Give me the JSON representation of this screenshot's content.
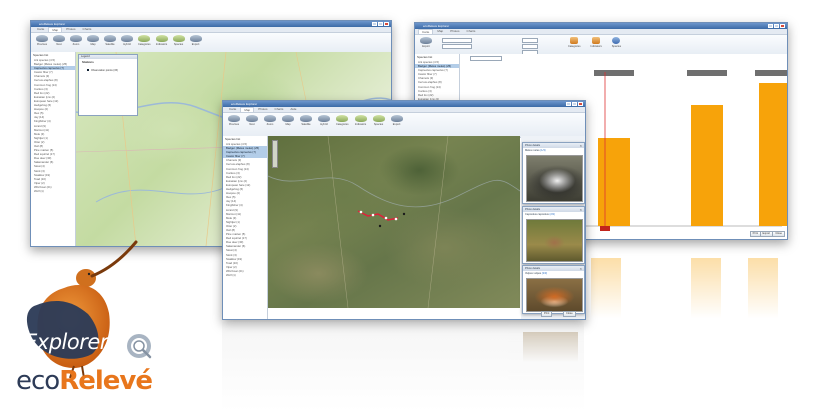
{
  "app": {
    "title": "ecoReleve Explorer",
    "brand_word1": "Explorer",
    "brand_eco": "eco",
    "brand_releve": "Relevé",
    "brand_orange": "#e8761c",
    "brand_blue": "#2d3b57"
  },
  "tabs": [
    "Carte",
    "Map",
    "Photos",
    "Charts",
    "Aide"
  ],
  "toolbar": {
    "labels": [
      "Previous",
      "Next",
      "Zoom",
      "Map",
      "Satellite",
      "Hybrid",
      "Categories",
      "Indicators",
      "Species",
      "Export"
    ]
  },
  "species_header": "Species list",
  "species": [
    "Ant species (4.5)",
    "Badger (Meles meles) (25)",
    "Capreolus capreolus (7)",
    "Castor fiber (7)",
    "Chamois (3)",
    "Cervus elaphus (8)",
    "Common frog (14)",
    "Cuckoo (3)",
    "Red fox (22)",
    "Eurasian lynx (2)",
    "European hare (12)",
    "Hedgehog (6)",
    "Hoopoe (2)",
    "Ibex (5)",
    "Jay (14)",
    "Kingfisher (4)",
    "Lizard (9)",
    "Marmot (11)",
    "Mole (3)",
    "Nightjar (1)",
    "Otter (2)",
    "Owl (8)",
    "Pine marten (5)",
    "Red squirrel (17)",
    "Roe deer (30)",
    "Salamander (6)",
    "Stoat (4)",
    "Stork (3)",
    "Swallow (19)",
    "Toad (10)",
    "Viper (2)",
    "Wild boar (21)",
    "Wolf (1)"
  ],
  "legend_panel": {
    "title": "Legend",
    "heading": "Stations",
    "item": "Observation points (15)"
  },
  "photos": [
    {
      "title": "Photo details",
      "caption": "Meles meles",
      "count": "(1/3)"
    },
    {
      "title": "Photo details",
      "caption": "Capreolus capreolus",
      "count": "(2/3)"
    },
    {
      "title": "Photo details",
      "caption": "Vulpes vulpes",
      "count": "(3/3)"
    }
  ],
  "chart_data": {
    "type": "bar",
    "categories": [
      "",
      "",
      "",
      ""
    ],
    "values": [
      80,
      80,
      110,
      130
    ],
    "ylim": [
      0,
      140
    ],
    "grid": false,
    "bar_color": "#f7a30a"
  },
  "buttons": {
    "print": "Print",
    "export": "Export",
    "close": "Close"
  },
  "colors": {
    "titlebar": "#3b6aa6",
    "selection": "#b3cde8",
    "accent_orange": "#f7a30a"
  }
}
